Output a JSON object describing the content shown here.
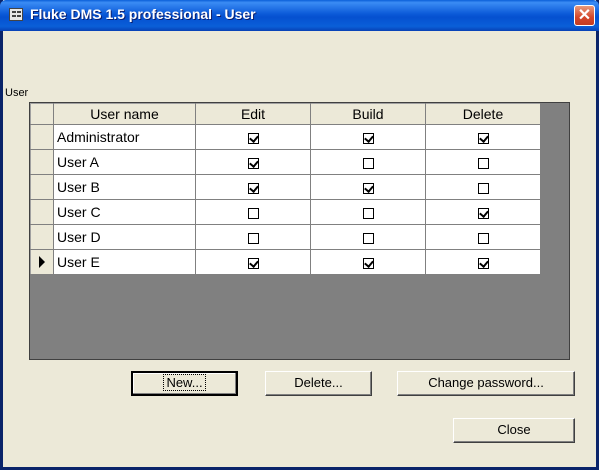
{
  "window": {
    "title": "Fluke DMS 1.5 professional - User",
    "close_glyph": "✕"
  },
  "group_label": "User",
  "table": {
    "columns": [
      "User name",
      "Edit",
      "Build",
      "Delete"
    ],
    "rows": [
      {
        "name": "Administrator",
        "edit": true,
        "build": true,
        "delete": true,
        "current": false
      },
      {
        "name": "User A",
        "edit": true,
        "build": false,
        "delete": false,
        "current": false
      },
      {
        "name": "User B",
        "edit": true,
        "build": true,
        "delete": false,
        "current": false
      },
      {
        "name": "User C",
        "edit": false,
        "build": false,
        "delete": true,
        "current": false
      },
      {
        "name": "User D",
        "edit": false,
        "build": false,
        "delete": false,
        "current": false
      },
      {
        "name": "User E",
        "edit": true,
        "build": true,
        "delete": true,
        "current": true
      }
    ]
  },
  "buttons": {
    "new": "New...",
    "delete": "Delete...",
    "change_password": "Change password...",
    "close": "Close"
  }
}
